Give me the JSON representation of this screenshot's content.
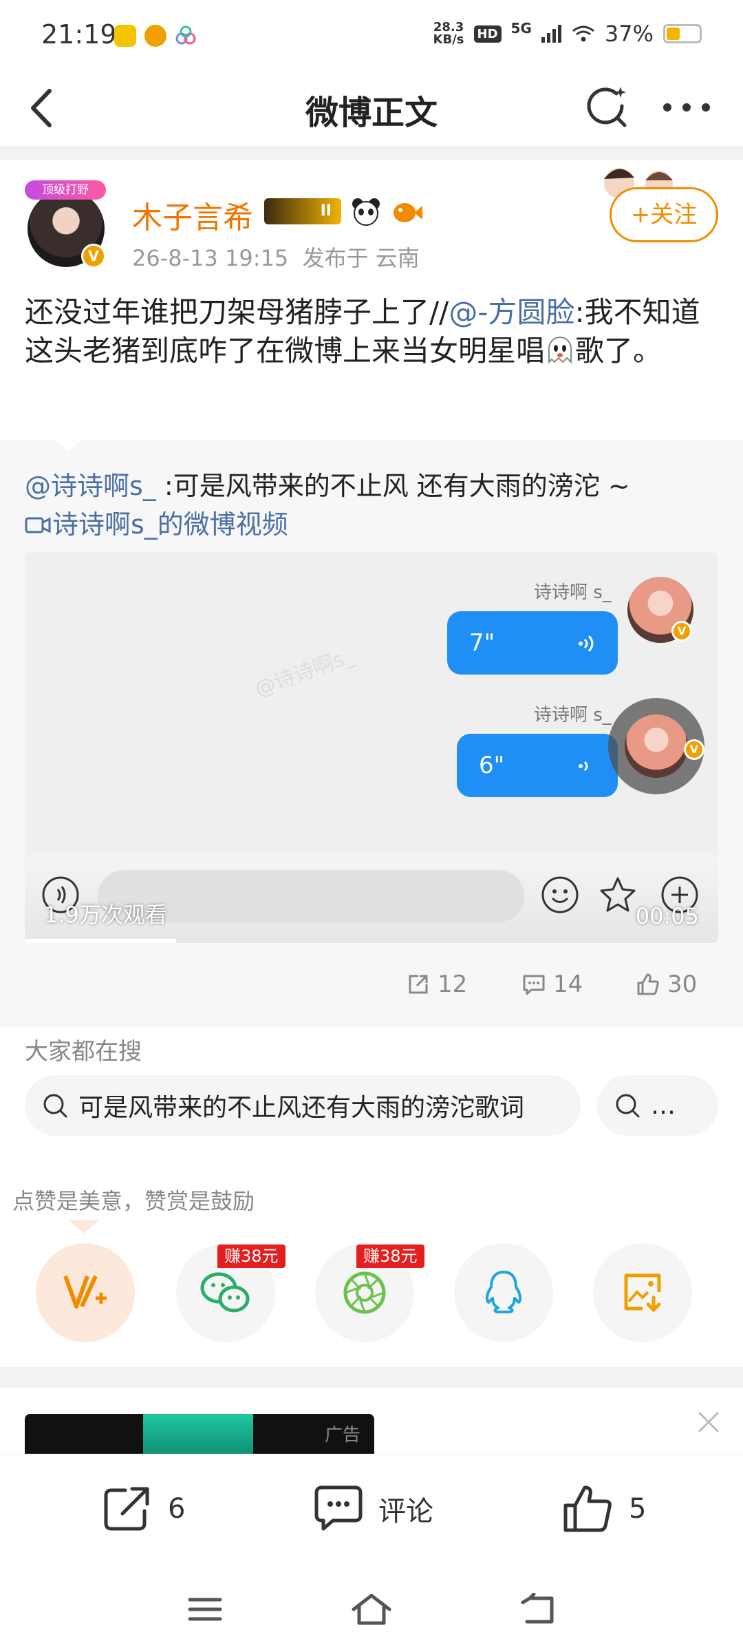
{
  "status_bar": {
    "time": "21:19",
    "net_speed_value": "28.3",
    "net_speed_unit": "KB/s",
    "hd": "HD",
    "network": "5G",
    "battery": "37%",
    "battery_level": 0.37
  },
  "nav": {
    "title": "微博正文"
  },
  "post": {
    "top_badge": "顶级打野",
    "username": "木子言希",
    "level_badge": "II",
    "time": "26-8-13 19:15",
    "location": "发布于 云南",
    "follow_label": "+关注",
    "text_part1": "还没过年谁把刀架母猪脖子上了//",
    "mention": "@-方圆脸",
    "text_part2": ":我不知道这头老猪到底咋了在微博上来当女明星唱",
    "text_part3": "歌了。"
  },
  "repost": {
    "author": "@诗诗啊s_",
    "text": " :可是风带来的不止风 还有大雨的滂沱 ~",
    "video_link": "诗诗啊s_的微博视频",
    "video": {
      "sender_name_1": "诗诗啊 s_",
      "bubble_1": "7\"",
      "sender_name_2": "诗诗啊 s_",
      "bubble_2": "6\"",
      "watermark": "@诗诗啊s_",
      "views": "1.9万次观看",
      "duration": "00:05"
    },
    "share_count": "12",
    "comment_count": "14",
    "like_count": "30"
  },
  "search": {
    "label": "大家都在搜",
    "query": "可是风带来的不止风还有大雨的滂沱歌词",
    "more": "…"
  },
  "reward": {
    "label": "点赞是美意，赞赏是鼓励",
    "wechat_tag": "赚38元",
    "moments_tag": "赚38元"
  },
  "ad": {
    "label": "广告"
  },
  "bottom_bar": {
    "share_count": "6",
    "comment_label": "评论",
    "like_count": "5"
  },
  "colors": {
    "accent_orange": "#f27500",
    "link_blue": "#4a6fa5",
    "bubble_blue": "#1f8ff5",
    "tag_red": "#e31f1f"
  }
}
